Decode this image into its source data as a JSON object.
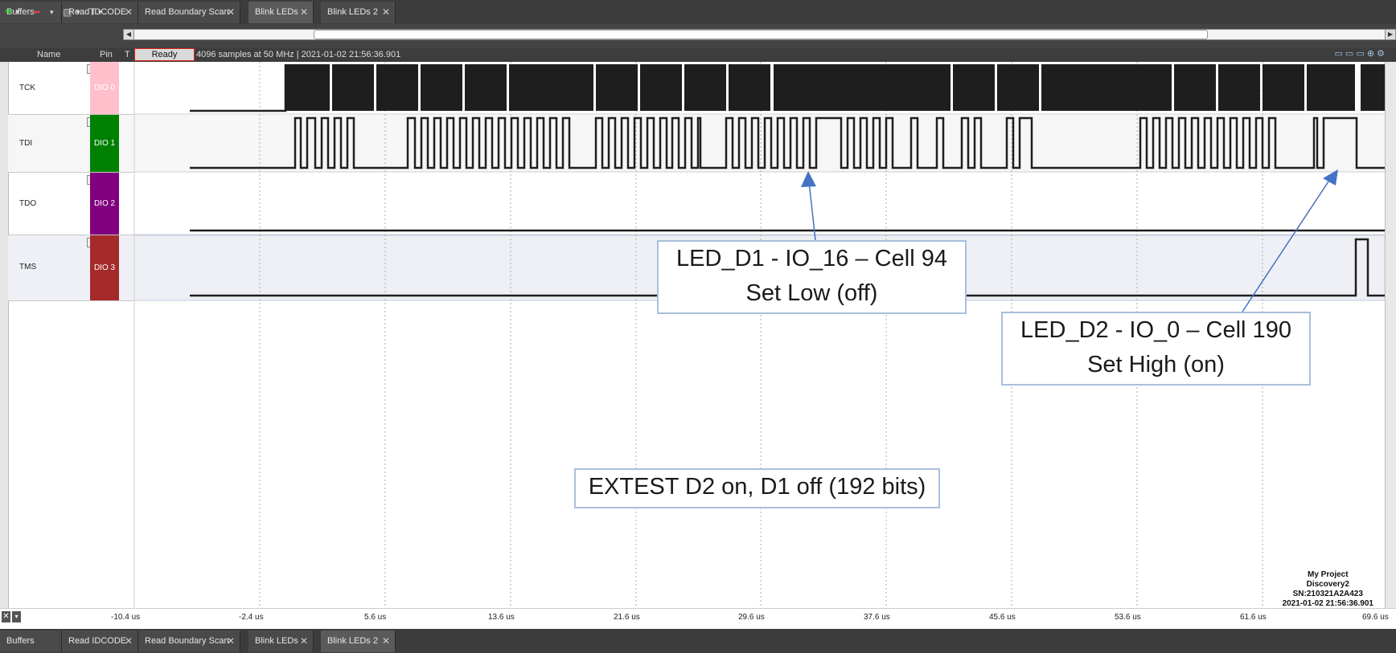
{
  "tabs_top": [
    {
      "label": "Buffers",
      "closable": false,
      "active": false
    },
    {
      "label": "Read IDCODE",
      "closable": true,
      "active": false
    },
    {
      "label": "Read Boundary Scan",
      "closable": true,
      "active": false
    },
    {
      "label": "Blink LEDs",
      "closable": true,
      "active": true
    },
    {
      "label": "Blink LEDs 2",
      "closable": true,
      "active": false
    }
  ],
  "tabs_bottom": [
    {
      "label": "Buffers",
      "closable": false,
      "active": false
    },
    {
      "label": "Read IDCODE",
      "closable": true,
      "active": false
    },
    {
      "label": "Read Boundary Scan",
      "closable": true,
      "active": false
    },
    {
      "label": "Blink LEDs",
      "closable": true,
      "active": false
    },
    {
      "label": "Blink LEDs 2",
      "closable": true,
      "active": true
    }
  ],
  "toolbar": {
    "add_icon": "plus-icon",
    "remove_icon": "minus-icon",
    "edit_icon": "edit-icon",
    "text_icon": "T"
  },
  "header": {
    "name_col": "Name",
    "pin_col": "Pin",
    "t_col": "T",
    "status": "Ready",
    "info": "4096 samples at 50 MHz | 2021-01-02 21:56:36.901"
  },
  "signals": [
    {
      "name": "TCK",
      "pin": "DIO 0",
      "color": "#ffc0cb"
    },
    {
      "name": "TDI",
      "pin": "DIO 1",
      "color": "#008000"
    },
    {
      "name": "TDO",
      "pin": "DIO 2",
      "color": "#800080"
    },
    {
      "name": "TMS",
      "pin": "DIO 3",
      "color": "#a52a2a"
    }
  ],
  "annotations": {
    "d1": {
      "line1": "LED_D1 - IO_16 – Cell 94",
      "line2": "Set Low (off)"
    },
    "d2": {
      "line1": "LED_D2 - IO_0 – Cell 190",
      "line2": "Set High (on)"
    },
    "extest": "EXTEST D2 on, D1 off (192 bits)"
  },
  "axis": {
    "ticks": [
      "-10.4 us",
      "-2.4 us",
      "5.6 us",
      "13.6 us",
      "21.6 us",
      "29.6 us",
      "37.6 us",
      "45.6 us",
      "53.6 us",
      "61.6 us",
      "69.6 us"
    ]
  },
  "device_info": {
    "project": "My Project",
    "device": "Discovery2",
    "serial": "SN:210321A2A423",
    "timestamp": "2021-01-02 21:56:36.901"
  },
  "colors": {
    "trace": "#1e1e1e",
    "callout_border": "#a9bfdc",
    "arrow": "#4472c4",
    "ready_border": "#e02020"
  }
}
